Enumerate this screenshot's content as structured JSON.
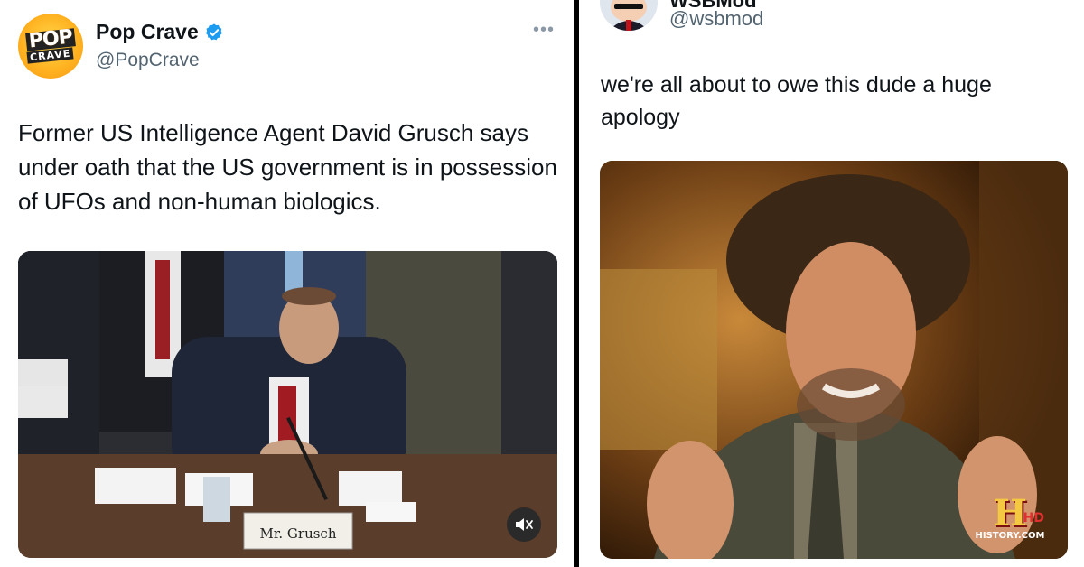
{
  "left_tweet": {
    "avatar": {
      "line1": "POP",
      "line2": "CRAVE"
    },
    "display_name": "Pop Crave",
    "verified_icon": "verified-badge-icon",
    "handle": "@PopCrave",
    "more_icon": "more-options-icon",
    "more_glyph": "•••",
    "text": "Former US Intelligence Agent David Grusch says under oath that the US government is in possession of UFOs and non-human biologics.",
    "media": {
      "nameplate": "Mr. Grusch",
      "mute_icon": "speaker-muted-icon",
      "cc_icon": "captions-icon"
    }
  },
  "right_tweet": {
    "display_name": "WSBMod",
    "handle": "@wsbmod",
    "text": "we're all about to owe this dude a huge apology",
    "media": {
      "logo_letter": "H",
      "logo_hd": "HD",
      "logo_url": "HISTORY.COM"
    }
  },
  "colors": {
    "verified": "#1d9bf0",
    "text_primary": "#0f1419",
    "text_secondary": "#536471",
    "divider": "#000000"
  }
}
